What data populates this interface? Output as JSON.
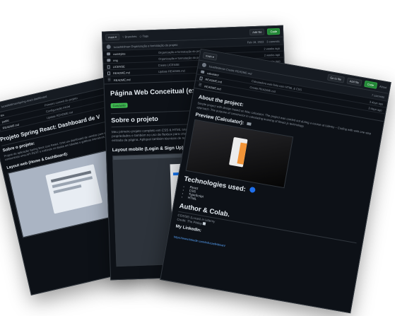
{
  "back_card": {
    "owner": "lucasfeldman/spring-react-dashboard",
    "files": [
      {
        "name": "src",
        "msg": "Primeiro commit do projeto"
      },
      {
        "name": "public",
        "msg": "Configuração inicial"
      },
      {
        "name": "README.md",
        "msg": "Update README.md"
      }
    ],
    "title": "Projeto Spring React: Dashboard de V",
    "section": "Sobre o projeto:",
    "text": "Projeto de aplicação Spring Boot com React. Criei um dashboard de vendas para estudo do ecossistema Spring, consumindo uma API REST e exibindo os dados em tabelas e gráficos interativos.",
    "layout_heading": "Layout web (Home & DashBoard):"
  },
  "mid_card": {
    "code_label": "Code",
    "commits_label": "3 commits",
    "add_file": "Add file",
    "branch": "main",
    "branches": "Branches",
    "tags": "Tags",
    "author": "lucasfeldman Organização e formatação do projeto",
    "time": "Feb 16, 2023",
    "files": [
      {
        "name": "css/styles",
        "msg": "Organização e formatação do projeto",
        "time": "2 weeks ago"
      },
      {
        "name": "img",
        "msg": "Organização e formatação do projeto",
        "time": "2 weeks ago"
      },
      {
        "name": "LICENSE",
        "msg": "Create LICENSE",
        "time": "3 weeks ago"
      },
      {
        "name": "README.md",
        "msg": "Update README.md",
        "time": "3 weeks ago"
      }
    ],
    "readme_tab": "README.md",
    "title": "Página Web Conceitual (ex-facebo",
    "badge": "Concluído",
    "section": "Sobre o projeto",
    "text": "Meu primeiro projeto completo em CSS & HTML totalmente responsivo. Nesse projeto eu aprendi diversas propriedades e também no uso de flexbox para criar a página de login do Facebook, com formulário de inscrição e entrada da página. Apliquei também técnicas de redirecionamento de páginas entre si, sendo elas a",
    "layout_heading": "Layout mobile (Login & Sign Up)"
  },
  "front_card": {
    "code_label": "Code",
    "about_label": "About",
    "add_file": "Add file",
    "go_to_file": "Go to file",
    "commits": "7 commits",
    "author": "lucasfeldman Create README.md",
    "files": [
      {
        "name": "calculator",
        "msg": "Calculadora web feita com HTML & CSS",
        "time": "3 days ago"
      },
      {
        "name": "README.md",
        "msg": "Create README.md",
        "time": "3 days ago"
      }
    ],
    "readme_tab": "README.md",
    "about_heading": "About the project:",
    "about_text": "Simple project with design based on Mac calculator. The project was carried out during a course at Udemy – Coding with web one step approach. The purpose of constructor in calculating learning of React.js technology.",
    "preview_heading": "Preview (Calculator):",
    "tech_heading": "Technologies used:",
    "techs": [
      "React",
      "CSS",
      "TypeScript",
      "HTML"
    ],
    "author_heading": "Author & Colab.",
    "author_lines": [
      "COSSEI (Lucas) in Udemy",
      "Credit: "
    ],
    "author_name": "The Pitday",
    "linkedin_heading": "My LinkedIn:",
    "linkedin_url": "https://www.linkedin.com/in/lucasfeldman/"
  }
}
